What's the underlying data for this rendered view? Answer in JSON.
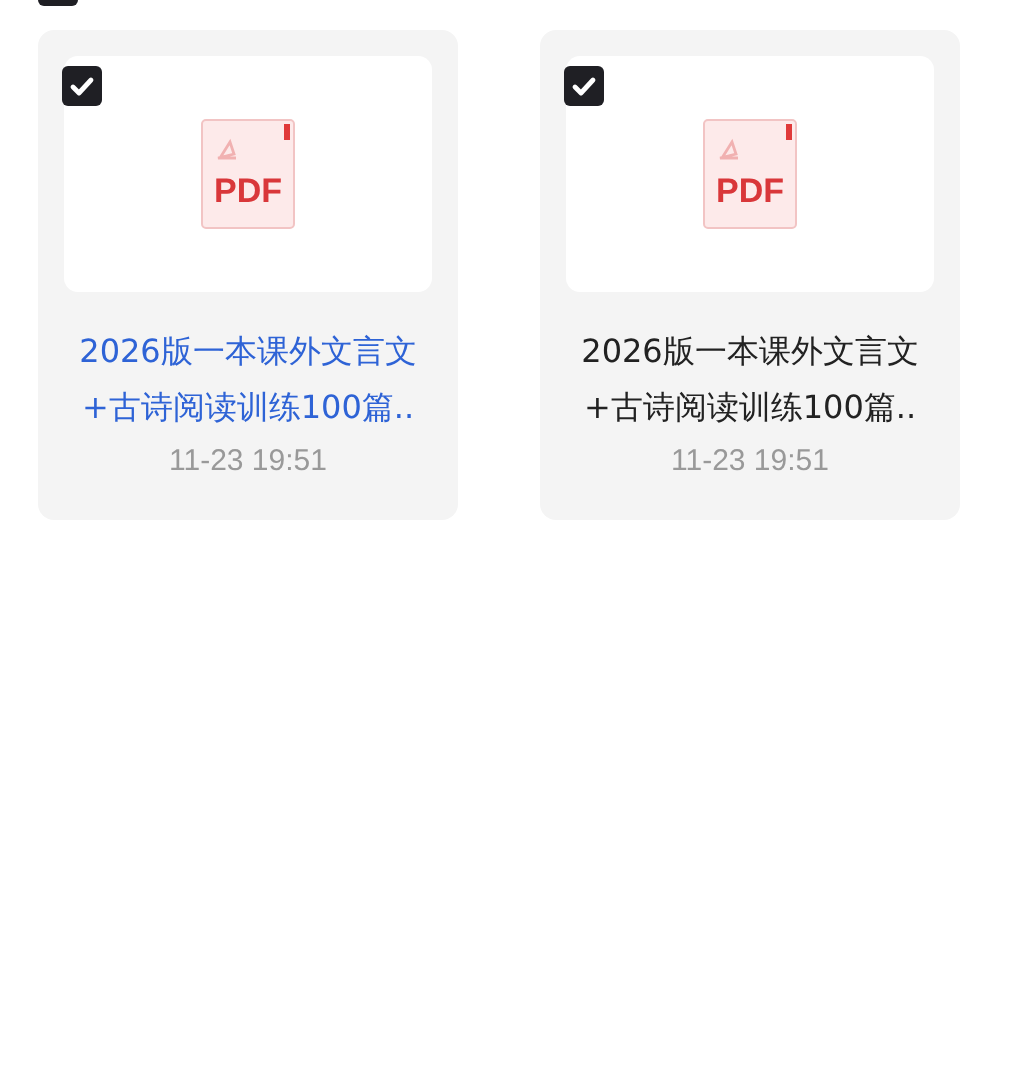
{
  "select_all": {
    "checked": true
  },
  "files": [
    {
      "name": "2026版一本课外文言文+古诗阅读训练100篇..",
      "icon_label": "PDF",
      "time": "11-23 19:51",
      "checked": true,
      "highlighted": true
    },
    {
      "name": "2026版一本课外文言文+古诗阅读训练100篇..",
      "icon_label": "PDF",
      "time": "11-23 19:51",
      "checked": true,
      "highlighted": false
    }
  ]
}
